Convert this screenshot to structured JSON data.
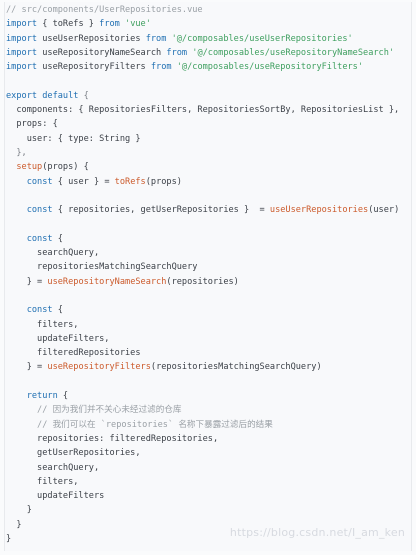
{
  "editor": {
    "lines": [
      [
        {
          "t": "// src/components/UserRepositories.vue",
          "c": "comment"
        }
      ],
      [
        {
          "t": "import",
          "c": "kw"
        },
        {
          "t": " { toRefs } ",
          "c": "id"
        },
        {
          "t": "from",
          "c": "kw"
        },
        {
          "t": " 'vue'",
          "c": "str"
        }
      ],
      [
        {
          "t": "import",
          "c": "kw"
        },
        {
          "t": " useUserRepositories ",
          "c": "id"
        },
        {
          "t": "from",
          "c": "kw"
        },
        {
          "t": " '@/composables/useUserRepositories'",
          "c": "str"
        }
      ],
      [
        {
          "t": "import",
          "c": "kw"
        },
        {
          "t": " useRepositoryNameSearch ",
          "c": "id"
        },
        {
          "t": "from",
          "c": "kw"
        },
        {
          "t": " '@/composables/useRepositoryNameSearch'",
          "c": "str"
        }
      ],
      [
        {
          "t": "import",
          "c": "kw"
        },
        {
          "t": " useRepositoryFilters ",
          "c": "id"
        },
        {
          "t": "from",
          "c": "kw"
        },
        {
          "t": " '@/composables/useRepositoryFilters'",
          "c": "str"
        }
      ],
      [],
      [
        {
          "t": "export default",
          "c": "kw"
        },
        {
          "t": " {",
          "c": "punc"
        }
      ],
      [
        {
          "t": "  components: { RepositoriesFilters, RepositoriesSortBy, RepositoriesList },",
          "c": "id"
        }
      ],
      [
        {
          "t": "  props: {",
          "c": "id"
        }
      ],
      [
        {
          "t": "    user: { type: String }",
          "c": "id"
        }
      ],
      [
        {
          "t": "  },",
          "c": "punc"
        }
      ],
      [
        {
          "t": "  ",
          "c": "id"
        },
        {
          "t": "setup",
          "c": "fn"
        },
        {
          "t": "(props) {",
          "c": "id"
        }
      ],
      [
        {
          "t": "    ",
          "c": "id"
        },
        {
          "t": "const",
          "c": "kw"
        },
        {
          "t": " { user } = ",
          "c": "id"
        },
        {
          "t": "toRefs",
          "c": "fn"
        },
        {
          "t": "(props)",
          "c": "id"
        }
      ],
      [],
      [
        {
          "t": "    ",
          "c": "id"
        },
        {
          "t": "const",
          "c": "kw"
        },
        {
          "t": " { repositories, getUserRepositories }  = ",
          "c": "id"
        },
        {
          "t": "useUserRepositories",
          "c": "fn"
        },
        {
          "t": "(user)",
          "c": "id"
        }
      ],
      [],
      [
        {
          "t": "    ",
          "c": "id"
        },
        {
          "t": "const",
          "c": "kw"
        },
        {
          "t": " {",
          "c": "id"
        }
      ],
      [
        {
          "t": "      searchQuery,",
          "c": "id"
        }
      ],
      [
        {
          "t": "      repositoriesMatchingSearchQuery",
          "c": "id"
        }
      ],
      [
        {
          "t": "    } = ",
          "c": "id"
        },
        {
          "t": "useRepositoryNameSearch",
          "c": "fn"
        },
        {
          "t": "(repositories)",
          "c": "id"
        }
      ],
      [],
      [
        {
          "t": "    ",
          "c": "id"
        },
        {
          "t": "const",
          "c": "kw"
        },
        {
          "t": " {",
          "c": "id"
        }
      ],
      [
        {
          "t": "      filters,",
          "c": "id"
        }
      ],
      [
        {
          "t": "      updateFilters,",
          "c": "id"
        }
      ],
      [
        {
          "t": "      filteredRepositories",
          "c": "id"
        }
      ],
      [
        {
          "t": "    } = ",
          "c": "id"
        },
        {
          "t": "useRepositoryFilters",
          "c": "fn"
        },
        {
          "t": "(repositoriesMatchingSearchQuery)",
          "c": "id"
        }
      ],
      [],
      [
        {
          "t": "    ",
          "c": "id"
        },
        {
          "t": "return",
          "c": "kw"
        },
        {
          "t": " {",
          "c": "id"
        }
      ],
      [
        {
          "t": "      // 因为我们并不关心未经过滤的仓库",
          "c": "comment"
        }
      ],
      [
        {
          "t": "      // 我们可以在 `repositories` 名称下暴露过滤后的结果",
          "c": "comment"
        }
      ],
      [
        {
          "t": "      repositories: filteredRepositories,",
          "c": "id"
        }
      ],
      [
        {
          "t": "      getUserRepositories,",
          "c": "id"
        }
      ],
      [
        {
          "t": "      searchQuery,",
          "c": "id"
        }
      ],
      [
        {
          "t": "      filters,",
          "c": "id"
        }
      ],
      [
        {
          "t": "      updateFilters",
          "c": "id"
        }
      ],
      [
        {
          "t": "    }",
          "c": "id"
        }
      ],
      [
        {
          "t": "  }",
          "c": "id"
        }
      ],
      [
        {
          "t": "}",
          "c": "id"
        }
      ]
    ]
  },
  "watermark": "https://blog.csdn.net/I_am_ken"
}
